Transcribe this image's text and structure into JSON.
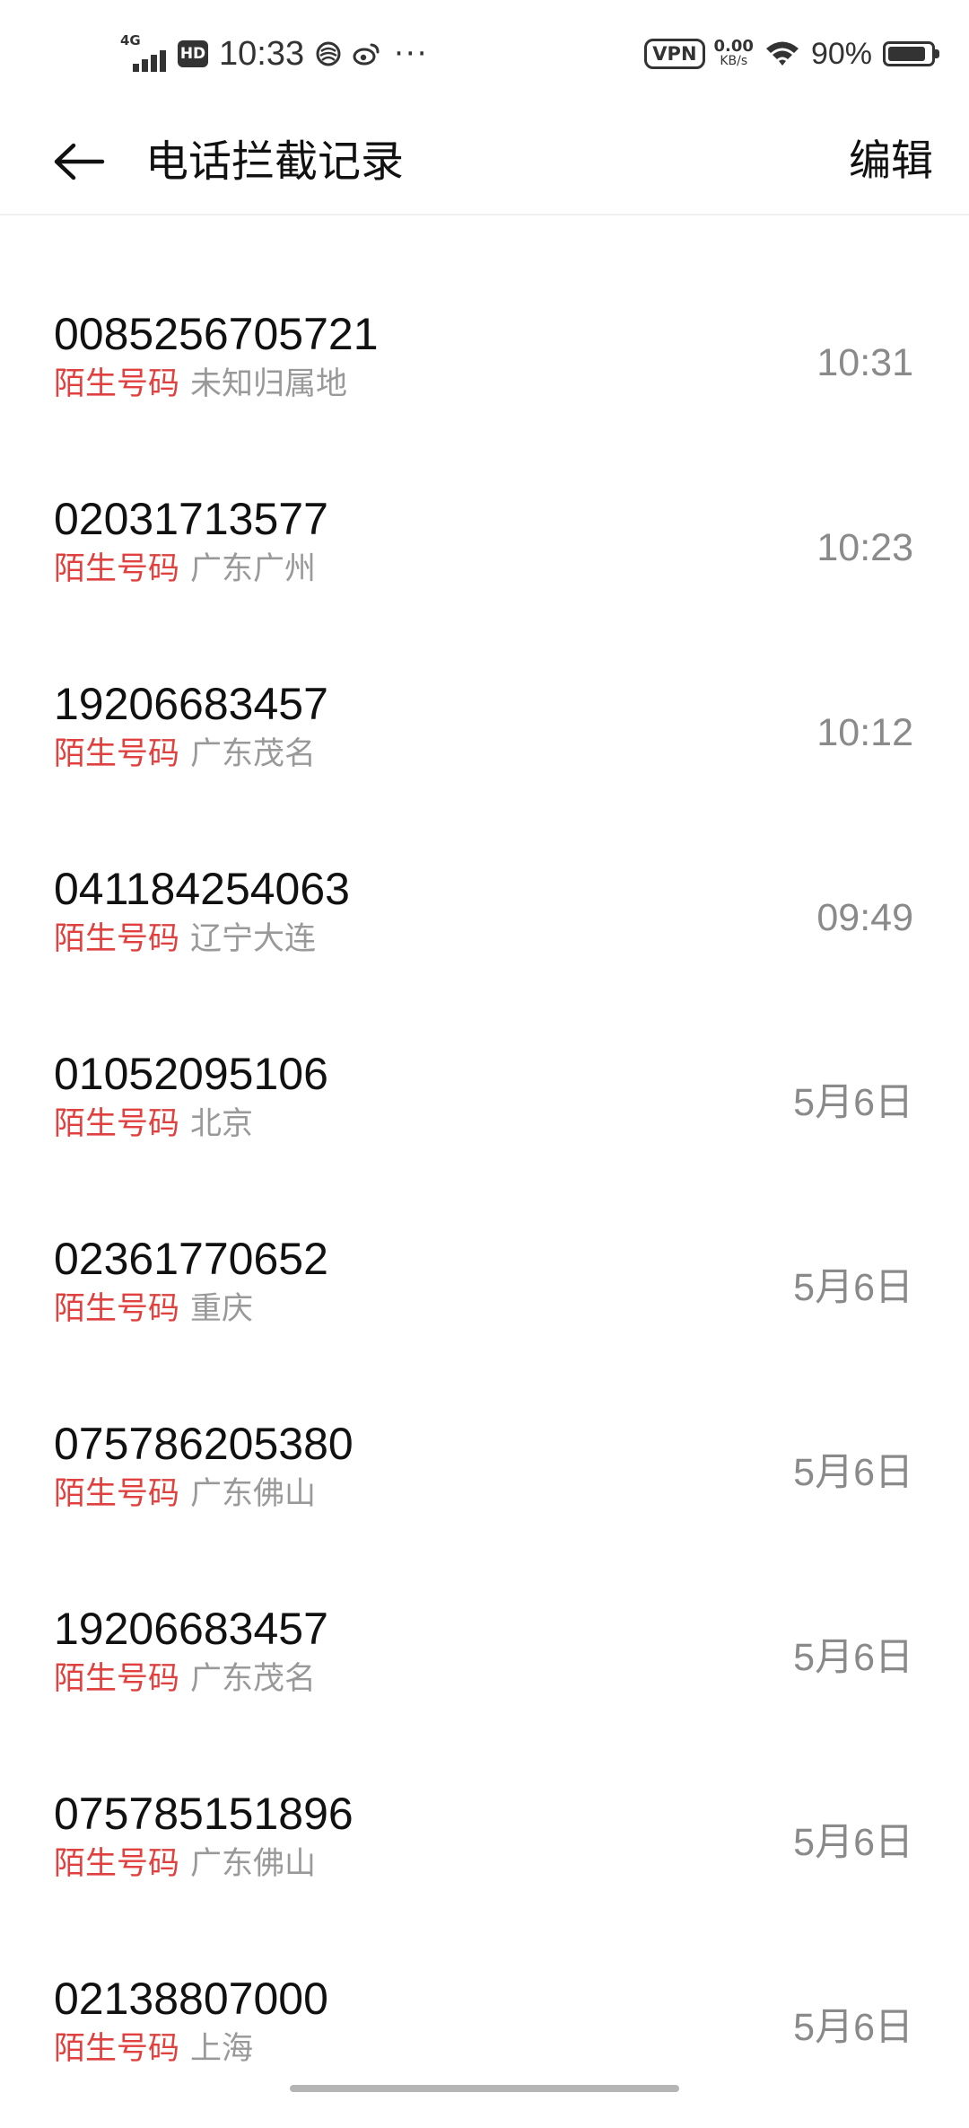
{
  "status_bar": {
    "network": "4G",
    "hd": "HD",
    "time": "10:33",
    "vpn": "VPN",
    "speed_value": "0.00",
    "speed_unit": "KB/s",
    "battery_percent": "90%",
    "battery_level": 0.9
  },
  "header": {
    "title": "电话拦截记录",
    "edit_label": "编辑"
  },
  "records": [
    {
      "number": "0085256705721",
      "tag": "陌生号码",
      "location": "未知归属地",
      "time": "10:31"
    },
    {
      "number": "02031713577",
      "tag": "陌生号码",
      "location": "广东广州",
      "time": "10:23"
    },
    {
      "number": "19206683457",
      "tag": "陌生号码",
      "location": "广东茂名",
      "time": "10:12"
    },
    {
      "number": "041184254063",
      "tag": "陌生号码",
      "location": "辽宁大连",
      "time": "09:49"
    },
    {
      "number": "01052095106",
      "tag": "陌生号码",
      "location": "北京",
      "time": "5月6日"
    },
    {
      "number": "02361770652",
      "tag": "陌生号码",
      "location": "重庆",
      "time": "5月6日"
    },
    {
      "number": "075786205380",
      "tag": "陌生号码",
      "location": "广东佛山",
      "time": "5月6日"
    },
    {
      "number": "19206683457",
      "tag": "陌生号码",
      "location": "广东茂名",
      "time": "5月6日"
    },
    {
      "number": "075785151896",
      "tag": "陌生号码",
      "location": "广东佛山",
      "time": "5月6日"
    },
    {
      "number": "02138807000",
      "tag": "陌生号码",
      "location": "上海",
      "time": "5月6日"
    }
  ],
  "colors": {
    "tag": "#e0403e",
    "location": "#999999",
    "time": "#8a8a8a"
  }
}
